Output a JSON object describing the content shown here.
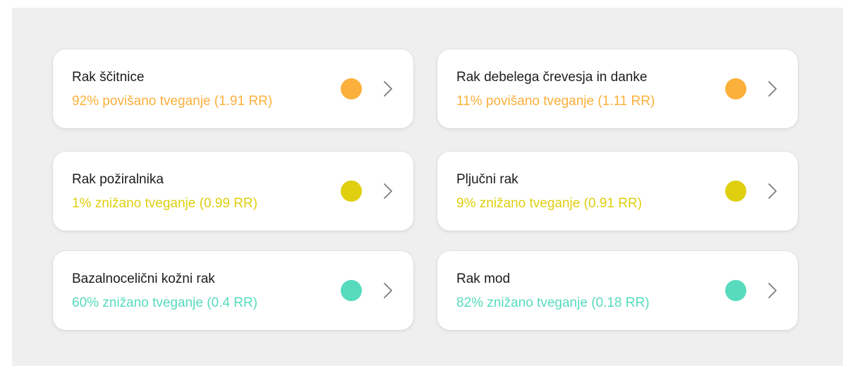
{
  "colors": {
    "orange": "#fbb03b",
    "yellow": "#dfcf0f",
    "teal": "#56dbbd",
    "chevron": "#7c7c7c"
  },
  "cards": [
    {
      "title": "Rak ščitnice",
      "risk": "92% povišano tveganje (1.91 RR)",
      "level": "orange",
      "icon": "chevron-right-icon"
    },
    {
      "title": "Rak debelega črevesja in danke",
      "risk": "11% povišano tveganje (1.11 RR)",
      "level": "orange",
      "icon": "chevron-right-icon"
    },
    {
      "title": "Rak požiralnika",
      "risk": "1% znižano tveganje (0.99 RR)",
      "level": "yellow",
      "icon": "chevron-right-icon"
    },
    {
      "title": "Pljučni rak",
      "risk": "9% znižano tveganje (0.91 RR)",
      "level": "yellow",
      "icon": "chevron-right-icon"
    },
    {
      "title": "Bazalnocelični kožni rak",
      "risk": "60% znižano tveganje (0.4 RR)",
      "level": "teal",
      "icon": "chevron-right-icon"
    },
    {
      "title": "Rak mod",
      "risk": "82% znižano tveganje (0.18 RR)",
      "level": "teal",
      "icon": "chevron-right-icon"
    }
  ]
}
